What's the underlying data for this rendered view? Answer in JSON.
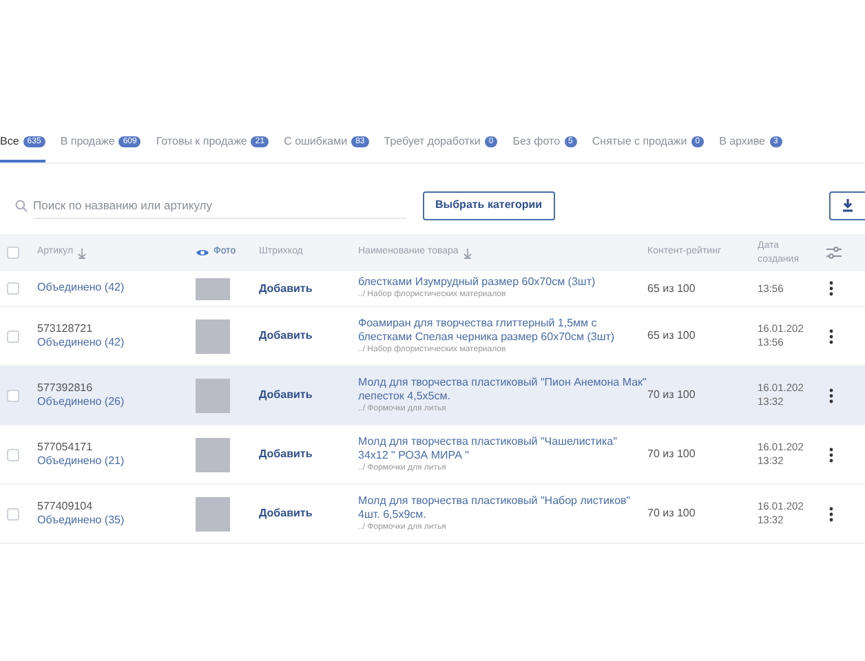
{
  "tabs": [
    {
      "label": "Все",
      "count": "635",
      "selected": true
    },
    {
      "label": "В продаже",
      "count": "609",
      "selected": false
    },
    {
      "label": "Готовы к продаже",
      "count": "21",
      "selected": false
    },
    {
      "label": "С ошибками",
      "count": "83",
      "selected": false
    },
    {
      "label": "Требует доработки",
      "count": "0",
      "selected": false
    },
    {
      "label": "Без фото",
      "count": "5",
      "selected": false
    },
    {
      "label": "Снятые с продажи",
      "count": "0",
      "selected": false
    },
    {
      "label": "В архиве",
      "count": "3",
      "selected": false
    }
  ],
  "search": {
    "placeholder": "Поиск по названию или артикулу"
  },
  "category_button": "Выбрать категории",
  "table": {
    "select_all_checked": false,
    "columns": [
      {
        "label": "Артикул",
        "sortable": true
      },
      {
        "label": "Фото",
        "sortable": false
      },
      {
        "label": "Штрихкод",
        "sortable": false
      },
      {
        "label": "Наименование товара",
        "sortable": true
      },
      {
        "label": "Контент-рейтинг",
        "sortable": false
      },
      {
        "label": "Дата создания",
        "sortable": false
      }
    ],
    "rows": [
      {
        "article": "",
        "merged": "Объединено (42)",
        "barcode": "Добавить",
        "name": "блестками Изумрудный размер 60x70см (3шт)",
        "category": "../ Набор флористических материалов",
        "rating": "65 из 100",
        "date": "",
        "time": "13:56",
        "hovered": false
      },
      {
        "article": "573128721",
        "merged": "Объединено (42)",
        "barcode": "Добавить",
        "name": "Фоамиран для творчества глиттерный 1,5мм с блестками Спелая черника размер 60x70см (3шт)",
        "category": "../ Набор флористических материалов",
        "rating": "65 из 100",
        "date": "16.01.202",
        "time": "13:56",
        "hovered": false
      },
      {
        "article": "577392816",
        "merged": "Объединено (26)",
        "barcode": "Добавить",
        "name": "Молд для творчества пластиковый \"Пион Анемона Мак\" лепесток 4,5х5см.",
        "category": "../ Формочки для литья",
        "rating": "70 из 100",
        "date": "16.01.202",
        "time": "13:32",
        "hovered": true
      },
      {
        "article": "577054171",
        "merged": "Объединено (21)",
        "barcode": "Добавить",
        "name": "Молд для творчества пластиковый \"Чашелистика\" 34х12 \" РОЗА МИРА \"",
        "category": "../ Формочки для литья",
        "rating": "70 из 100",
        "date": "16.01.202",
        "time": "13:32",
        "hovered": false
      },
      {
        "article": "577409104",
        "merged": "Объединено (35)",
        "barcode": "Добавить",
        "name": "Молд для творчества пластиковый \"Набор листиков\" 4шт. 6,5х9см.",
        "category": "../ Формочки для литья",
        "rating": "70 из 100",
        "date": "16.01.202",
        "time": "13:32",
        "hovered": false
      }
    ]
  }
}
